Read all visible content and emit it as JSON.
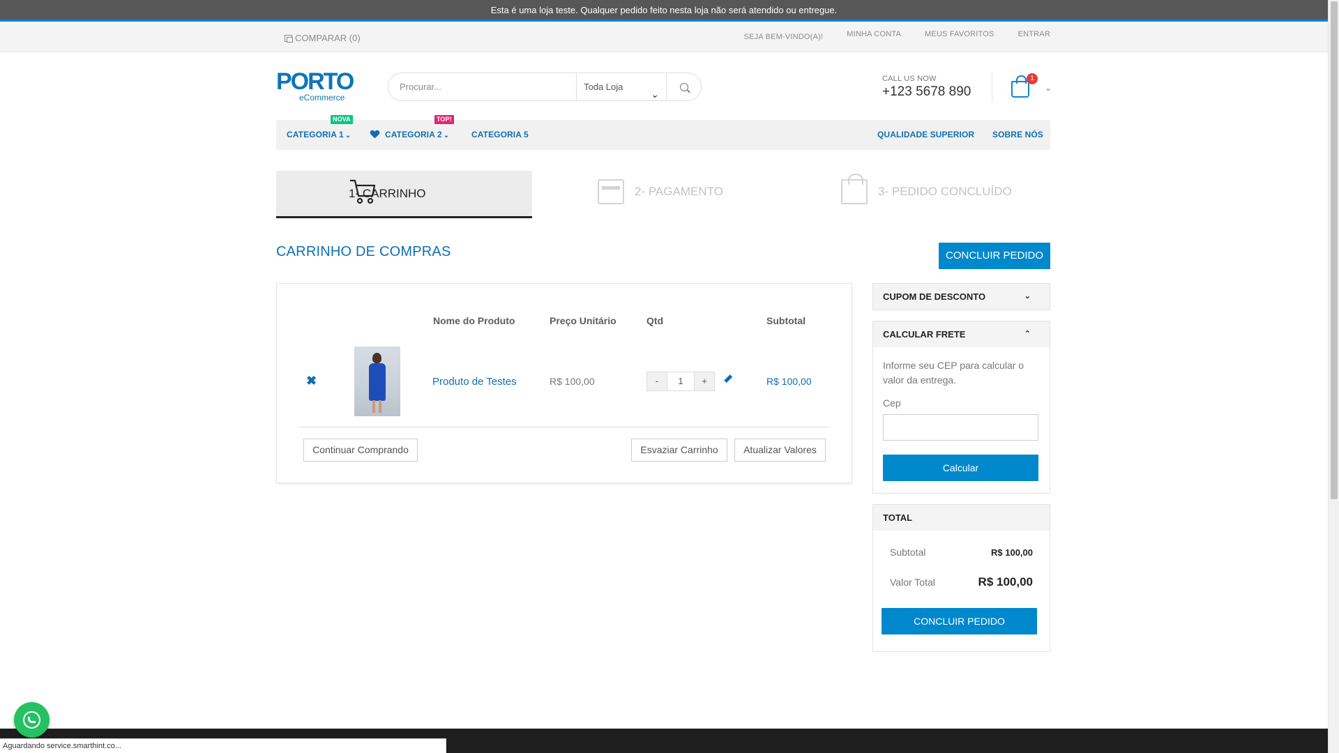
{
  "notice": "Esta é uma loja teste. Qualquer pedido feito nesta loja não será atendido ou entregue.",
  "topbar": {
    "compare": "COMPARAR (0)",
    "links": [
      "SEJA BEM-VINDO(A)!",
      "MINHA CONTA",
      "MEUS FAVORITOS",
      "ENTRAR"
    ]
  },
  "logo": {
    "brand": "PORTO",
    "sub": "eCommerce"
  },
  "search": {
    "placeholder": "Procurar...",
    "scope": "Toda Loja"
  },
  "contact": {
    "label": "CALL US NOW",
    "phone": "+123 5678 890"
  },
  "cart": {
    "count": "1"
  },
  "nav": {
    "items": [
      {
        "label": "CATEGORIA 1",
        "tag": "NOVA"
      },
      {
        "label": "CATEGORIA 2",
        "tag": "TOP!"
      },
      {
        "label": "CATEGORIA 5"
      }
    ],
    "right": [
      "QUALIDADE SUPERIOR",
      "SOBRE NÓS"
    ]
  },
  "steps": [
    "1- CARRINHO",
    "2- PAGAMENTO",
    "3- PEDIDO CONCLUÍDO"
  ],
  "page_title": "CARRINHO DE COMPRAS",
  "checkout_button": "CONCLUIR PEDIDO",
  "table": {
    "headers": [
      "Nome do Produto",
      "Preço Unitário",
      "Qtd",
      "Subtotal"
    ],
    "rows": [
      {
        "name": "Produto de Testes",
        "price": "R$ 100,00",
        "qty": "1",
        "subtotal": "R$ 100,00"
      }
    ],
    "qty_minus": "-",
    "qty_plus": "+"
  },
  "actions": {
    "continue": "Continuar Comprando",
    "empty": "Esvaziar Carrinho",
    "update": "Atualizar Valores"
  },
  "coupon": {
    "title": "CUPOM DE DESCONTO"
  },
  "shipping": {
    "title": "CALCULAR FRETE",
    "text": "Informe seu CEP para calcular o valor da entrega.",
    "cep_label": "Cep",
    "cep_value": "",
    "button": "Calcular"
  },
  "totals": {
    "title": "TOTAL",
    "subtotal_label": "Subtotal",
    "subtotal_value": "R$ 100,00",
    "total_label": "Valor Total",
    "total_value": "R$ 100,00",
    "button": "CONCLUIR PEDIDO"
  },
  "status_bar": "Aguardando service.smarthint.co...",
  "colors": {
    "brand": "#0088cc",
    "link": "#0f6fb3",
    "badge": "#e53b3b",
    "whatsapp": "#25c163"
  }
}
